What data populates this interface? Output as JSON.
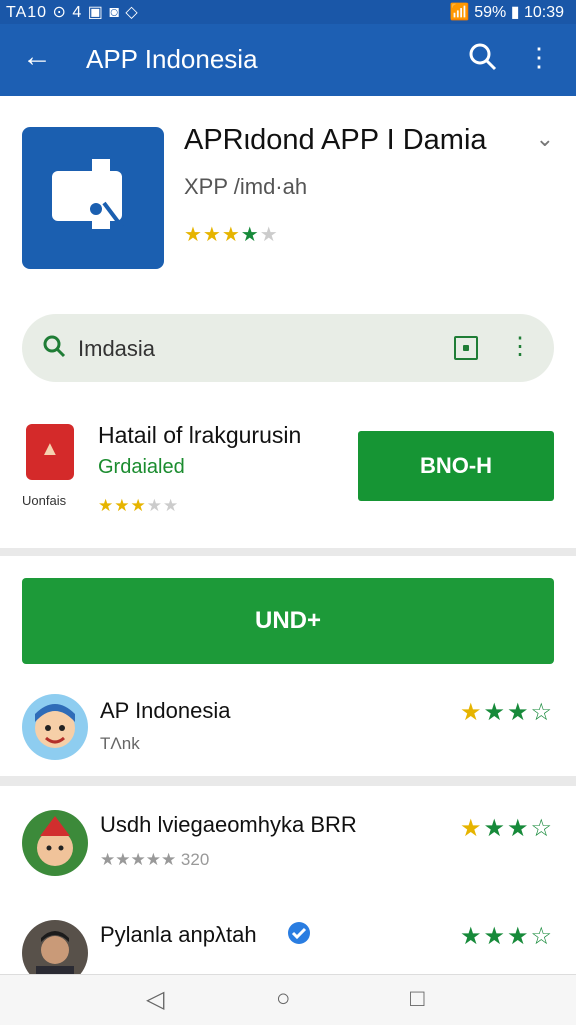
{
  "status_bar": {
    "left": "TA10 ⊙ 4 ▣ ◙ ◇",
    "battery": "59%",
    "time": "10:39"
  },
  "app_bar": {
    "title": "APP Indonesia"
  },
  "app": {
    "title": "APRιdond APP I Damia",
    "subtitle": "ΧPP /imd·ah",
    "rating": 4
  },
  "search": {
    "value": "Imdasia"
  },
  "related_app": {
    "title": "Hatail of lrakgurusin",
    "status": "Grdaialed",
    "caption": "Uonfais",
    "button_label": "BNO-H",
    "rating": 3.5
  },
  "install_button": {
    "label": "UND+"
  },
  "reviews": [
    {
      "name": "AP Indonesia",
      "sub": "TΛnk",
      "stars_label": "★★★☆"
    },
    {
      "name": "Usdh lviegaeomhyka BRR",
      "rating_text": "★★★★★ 320",
      "stars_label": "★★★☆"
    },
    {
      "name": "Pylanla anpλtah",
      "stars_label": "★★★☆"
    }
  ],
  "colors": {
    "primary": "#1d5fb3",
    "accent_green": "#169534",
    "star_gold": "#e6b400"
  }
}
